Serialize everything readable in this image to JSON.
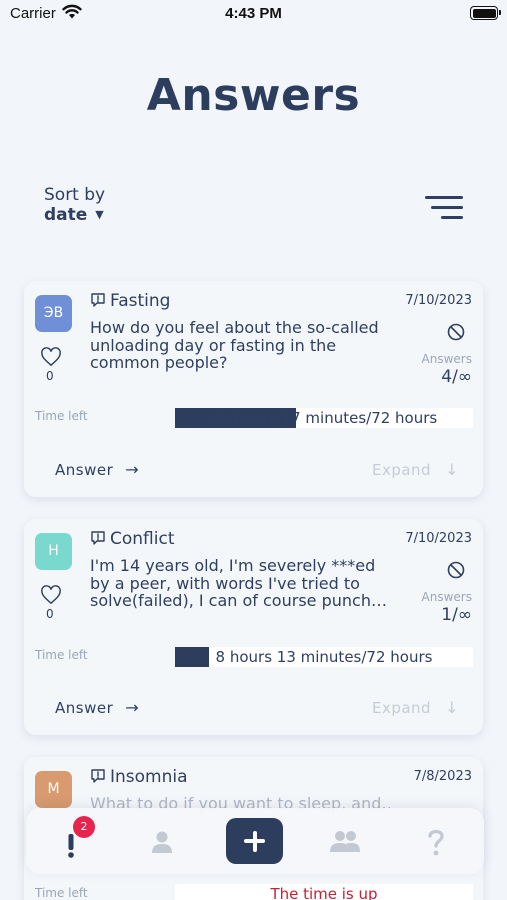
{
  "status_bar": {
    "carrier": "Carrier",
    "time": "4:43 PM"
  },
  "page": {
    "title": "Answers"
  },
  "sort": {
    "label": "Sort by",
    "value": "date"
  },
  "cards": [
    {
      "avatar_text": "ЭВ",
      "avatar_color": "#6f8fd6",
      "topic": "Fasting",
      "date": "7/10/2023",
      "question": "How do you feel about the so-called unloading day or fasting in the common people?",
      "likes": "0",
      "answers_label": "Answers",
      "answers_count": "4/∞",
      "time_left_label": "Time left",
      "time_text": "29 hours 17 minutes/72 hours",
      "progress_fraction": 0.407,
      "answer_label": "Answer",
      "expand_label": "Expand"
    },
    {
      "avatar_text": "Н",
      "avatar_color": "#7ad9cf",
      "topic": "Conflict",
      "date": "7/10/2023",
      "question": "I'm 14 years old, I'm severely ***ed by a peer, with words I've tried to solve(failed), I can of course punch…",
      "likes": "0",
      "answers_label": "Answers",
      "answers_count": "1/∞",
      "time_left_label": "Time left",
      "time_text": "8 hours 13 minutes/72 hours",
      "progress_fraction": 0.114,
      "answer_label": "Answer",
      "expand_label": "Expand"
    },
    {
      "avatar_text": "М",
      "avatar_color": "#d89a6e",
      "topic": "Insomnia",
      "date": "7/8/2023",
      "question": "What to do if you want to sleep, and…",
      "time_left_label": "Time left",
      "time_text": "The time is up"
    }
  ],
  "tab_bar": {
    "badge_count": "2",
    "items": [
      "exclamation-icon",
      "profile-icon",
      "add-icon",
      "users-icon",
      "help-icon"
    ]
  },
  "colors": {
    "primary": "#2d3d5e",
    "background": "#f2f5f9",
    "badge": "#e8234d",
    "time_up": "#c62033"
  }
}
